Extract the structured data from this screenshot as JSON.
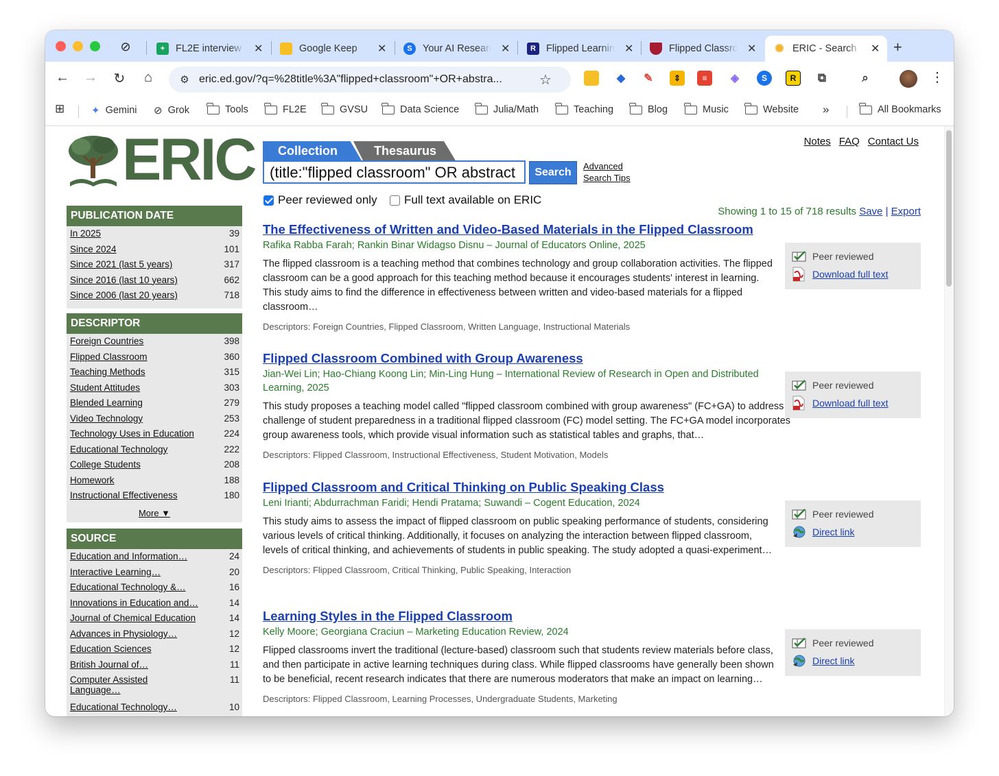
{
  "browser": {
    "tabs": [
      {
        "title": "FL2E interview",
        "fav_color": "#1aa260",
        "fav_glyph": "+"
      },
      {
        "title": "Google Keep",
        "fav_color": "#f6bf26",
        "fav_glyph": ""
      },
      {
        "title": "Your AI Research",
        "fav_color": "#1a73e8",
        "fav_glyph": "S"
      },
      {
        "title": "Flipped Learning",
        "fav_color": "#1a237e",
        "fav_glyph": "R"
      },
      {
        "title": "Flipped Classroom",
        "fav_color": "#a51c30",
        "fav_glyph": ""
      },
      {
        "title": "ERIC - Search",
        "fav_color": "#f2b632",
        "fav_glyph": "✺"
      }
    ],
    "new_tab_glyph": "+",
    "url": "eric.ed.gov/?q=%28title%3A\"flipped+classroom\"+OR+abstra...",
    "bookmarks": [
      {
        "label": "Gemini",
        "icon": "gemini-icon"
      },
      {
        "label": "Grok",
        "icon": "grok-icon"
      },
      {
        "label": "Tools",
        "icon": "folder-icon"
      },
      {
        "label": "FL2E",
        "icon": "folder-icon"
      },
      {
        "label": "GVSU",
        "icon": "folder-icon"
      },
      {
        "label": "Data Science",
        "icon": "folder-icon"
      },
      {
        "label": "Julia/Math",
        "icon": "folder-icon"
      },
      {
        "label": "Teaching",
        "icon": "folder-icon"
      },
      {
        "label": "Blog",
        "icon": "folder-icon"
      },
      {
        "label": "Music",
        "icon": "folder-icon"
      },
      {
        "label": "Website",
        "icon": "folder-icon"
      }
    ],
    "overflow_glyph": "»",
    "all_bookmarks": "All Bookmarks"
  },
  "site": {
    "logo_text": "ERIC",
    "top_links": [
      "Notes",
      "FAQ",
      "Contact Us"
    ]
  },
  "search": {
    "tab_collection": "Collection",
    "tab_thesaurus": "Thesaurus",
    "query": "(title:\"flipped classroom\" OR abstract",
    "button": "Search",
    "advanced_line1": "Advanced",
    "advanced_line2": "Search Tips",
    "peer_reviewed_label": "Peer reviewed only",
    "full_text_label": "Full text available on ERIC",
    "showing": "Showing 1 to 15 of 718 results",
    "save": "Save",
    "pipe": "|",
    "export": "Export"
  },
  "facets": {
    "publication_date": {
      "title": "PUBLICATION DATE",
      "items": [
        {
          "label": "In 2025",
          "count": "39"
        },
        {
          "label": "Since 2024",
          "count": "101"
        },
        {
          "label": "Since 2021 (last 5 years)",
          "count": "317"
        },
        {
          "label": "Since 2016 (last 10 years)",
          "count": "662"
        },
        {
          "label": "Since 2006 (last 20 years)",
          "count": "718"
        }
      ]
    },
    "descriptor": {
      "title": "DESCRIPTOR",
      "items": [
        {
          "label": "Foreign Countries",
          "count": "398"
        },
        {
          "label": "Flipped Classroom",
          "count": "360"
        },
        {
          "label": "Teaching Methods",
          "count": "315"
        },
        {
          "label": "Student Attitudes",
          "count": "303"
        },
        {
          "label": "Blended Learning",
          "count": "279"
        },
        {
          "label": "Video Technology",
          "count": "253"
        },
        {
          "label": "Technology Uses in Education",
          "count": "224"
        },
        {
          "label": "Educational Technology",
          "count": "222"
        },
        {
          "label": "College Students",
          "count": "208"
        },
        {
          "label": "Homework",
          "count": "188"
        },
        {
          "label": "Instructional Effectiveness",
          "count": "180"
        }
      ],
      "more": "More ▼"
    },
    "source": {
      "title": "SOURCE",
      "items": [
        {
          "label": "Education and Information…",
          "count": "24"
        },
        {
          "label": "Interactive Learning…",
          "count": "20"
        },
        {
          "label": "Educational Technology &…",
          "count": "16"
        },
        {
          "label": "Innovations in Education and…",
          "count": "14"
        },
        {
          "label": "Journal of Chemical Education",
          "count": "14"
        },
        {
          "label": "Advances in Physiology…",
          "count": "12"
        },
        {
          "label": "Education Sciences",
          "count": "12"
        },
        {
          "label": "British Journal of…",
          "count": "11"
        },
        {
          "label": "Computer Assisted Language…",
          "count": "11"
        },
        {
          "label": "Educational Technology…",
          "count": "10"
        }
      ]
    }
  },
  "results": [
    {
      "title": "The Effectiveness of Written and Video-Based Materials in the Flipped Classroom",
      "authors": "Rafika Rabba Farah; Rankin Binar Widagso Disnu – Journal of Educators Online, 2025",
      "abstract": "The flipped classroom is a teaching method that combines technology and group collaboration activities. The flipped classroom can be a good approach for this teaching method because it encourages students' interest in learning. This study aims to find the difference in effectiveness between written and video-based materials for a flipped classroom…",
      "descriptors": "Descriptors: Foreign Countries, Flipped Classroom, Written Language, Instructional Materials",
      "peer": "Peer reviewed",
      "access": "Download full text",
      "access_type": "pdf"
    },
    {
      "title": "Flipped Classroom Combined with Group Awareness",
      "authors": "Jian-Wei Lin; Hao-Chiang Koong Lin; Min-Ling Hung – International Review of Research in Open and Distributed Learning, 2025",
      "abstract": "This study proposes a teaching model called \"flipped classroom combined with group awareness\" (FC+GA) to address the challenge of student preparedness in a traditional flipped classroom (FC) model setting. The FC+GA model incorporates group awareness tools, which provide visual information such as statistical tables and graphs, that…",
      "descriptors": "Descriptors: Flipped Classroom, Instructional Effectiveness, Student Motivation, Models",
      "peer": "Peer reviewed",
      "access": "Download full text",
      "access_type": "pdf"
    },
    {
      "title": "Flipped Classroom and Critical Thinking on Public Speaking Class",
      "authors": "Leni Irianti; Abdurrachman Faridi; Hendi Pratama; Suwandi – Cogent Education, 2024",
      "abstract": "This study aims to assess the impact of flipped classroom on public speaking performance of students, considering various levels of critical thinking. Additionally, it focuses on analyzing the interaction between flipped classroom, levels of critical thinking, and achievements of students in public speaking. The study adopted a quasi-experiment…",
      "descriptors": "Descriptors: Flipped Classroom, Critical Thinking, Public Speaking, Interaction",
      "peer": "Peer reviewed",
      "access": "Direct link",
      "access_type": "link"
    },
    {
      "title": "Learning Styles in the Flipped Classroom",
      "authors": "Kelly Moore; Georgiana Craciun – Marketing Education Review, 2024",
      "abstract": "Flipped classrooms invert the traditional (lecture-based) classroom such that students review materials before class, and then participate in active learning techniques during class. While flipped classrooms have generally been shown to be beneficial, recent research indicates that there are numerous moderators that make an impact on learning…",
      "descriptors": "Descriptors: Flipped Classroom, Learning Processes, Undergraduate Students, Marketing",
      "peer": "Peer reviewed",
      "access": "Direct link",
      "access_type": "link"
    }
  ],
  "colors": {
    "accent_blue": "#3a7bd5",
    "facet_green": "#587a4d",
    "link_blue": "#1a3fb0",
    "author_green": "#2c7a2c"
  }
}
